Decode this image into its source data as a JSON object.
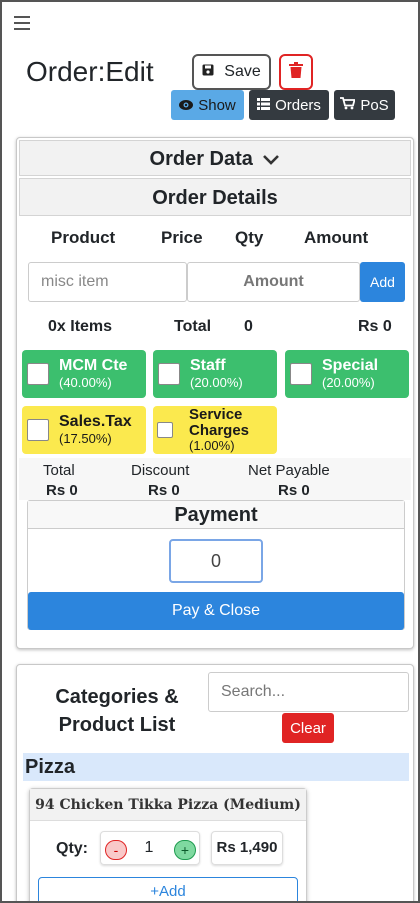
{
  "page": {
    "title": "Order:Edit"
  },
  "toolbar": {
    "save_label": "Save",
    "show_label": "Show",
    "orders_label": "Orders",
    "pos_label": "PoS"
  },
  "order_data": {
    "header": "Order Data",
    "details_header": "Order Details",
    "columns": [
      "Product",
      "Price",
      "Qty",
      "Amount"
    ],
    "misc_placeholder": "misc item",
    "amount_placeholder": "Amount",
    "add_label": "Add",
    "items_count": "0x Items",
    "total_label": "Total",
    "total_qty": "0",
    "total_amount": "Rs 0"
  },
  "taxes": [
    {
      "name": "MCM Cte",
      "percent": "(40.00%)",
      "color": "#3cbf6e",
      "checked": false
    },
    {
      "name": "Staff",
      "percent": "(20.00%)",
      "color": "#3cbf6e",
      "checked": false
    },
    {
      "name": "Special",
      "percent": "(20.00%)",
      "color": "#3cbf6e",
      "checked": false
    },
    {
      "name": "Sales.Tax",
      "percent": "(17.50%)",
      "color": "#fbe94e",
      "checked": false
    },
    {
      "name": "Service Charges",
      "percent": "(1.00%)",
      "color": "#fbe94e",
      "checked": false
    }
  ],
  "summary": {
    "total_label": "Total",
    "total_value": "Rs 0",
    "discount_label": "Discount",
    "discount_value": "Rs 0",
    "net_label": "Net Payable",
    "net_value": "Rs 0"
  },
  "payment": {
    "title": "Payment",
    "amount": "0",
    "pay_close_label": "Pay & Close"
  },
  "categories": {
    "title": "Categories & Product List",
    "search_placeholder": "Search...",
    "clear_label": "Clear",
    "groups": [
      {
        "name": "Pizza",
        "products": [
          {
            "name": "94 Chicken Tikka Pizza (Medium)",
            "qty_label": "Qty:",
            "minus": "-",
            "qty": "1",
            "plus": "+",
            "price": "Rs 1,490",
            "add_label": "+Add"
          }
        ]
      }
    ]
  },
  "colors": {
    "primary": "#2c85dd",
    "danger": "#e02424",
    "dark": "#343a40",
    "info": "#5aa9e6",
    "success": "#3cbf6e",
    "warning": "#fbe94e"
  }
}
